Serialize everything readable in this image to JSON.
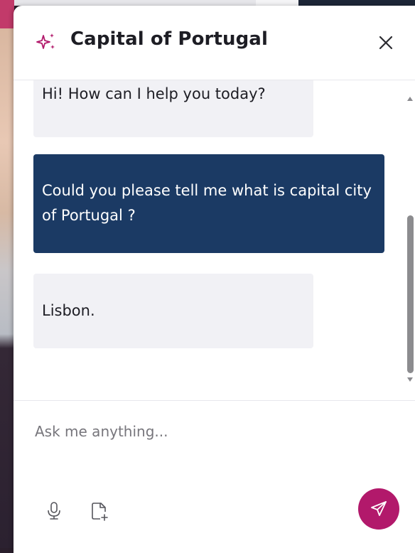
{
  "chat": {
    "title": "Capital of Portugal",
    "messages": [
      {
        "role": "bot",
        "text": "Hi! How can I help you today?"
      },
      {
        "role": "user",
        "text": "Could you please tell me what is capital city of Portugal ?"
      },
      {
        "role": "bot",
        "text": "Lisbon."
      }
    ]
  },
  "composer": {
    "placeholder": "Ask me anything...",
    "value": ""
  },
  "icons": {
    "header": "sparkle-icon",
    "close": "close-icon",
    "mic": "microphone-icon",
    "attach": "attach-file-icon",
    "send": "send-icon"
  },
  "colors": {
    "accent": "#b2196b",
    "user_bubble": "#1b3a64",
    "bot_bubble": "#f1f1f5"
  }
}
